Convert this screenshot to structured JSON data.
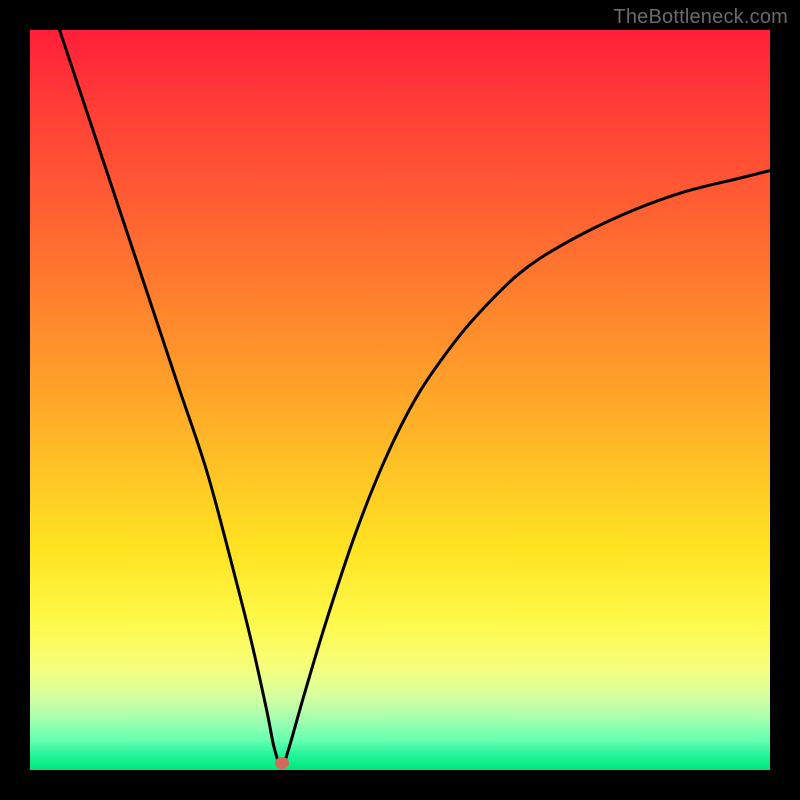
{
  "watermark": "TheBottleneck.com",
  "colors": {
    "frame": "#000000",
    "curve": "#000000",
    "marker": "#d46a5a",
    "gradient_top": "#ff1f3a",
    "gradient_bottom": "#00e57a"
  },
  "chart_data": {
    "type": "line",
    "title": "",
    "xlabel": "",
    "ylabel": "",
    "xlim": [
      0,
      100
    ],
    "ylim": [
      0,
      100
    ],
    "grid": false,
    "legend": false,
    "annotations": [],
    "marker": {
      "x": 34,
      "y": 1
    },
    "series": [
      {
        "name": "curve",
        "x": [
          4,
          8,
          12,
          16,
          20,
          24,
          28,
          30,
          32,
          33,
          34,
          35,
          37,
          40,
          44,
          48,
          52,
          56,
          60,
          66,
          72,
          80,
          88,
          96,
          100
        ],
        "y": [
          100,
          88,
          76,
          64,
          52,
          40,
          25,
          17,
          8,
          3,
          0.5,
          3,
          10,
          20,
          32,
          42,
          50,
          56,
          61,
          67,
          71,
          75,
          78,
          80,
          81
        ]
      }
    ]
  }
}
